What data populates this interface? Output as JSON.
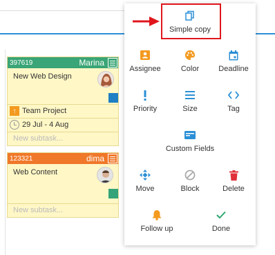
{
  "board": {
    "cards": [
      {
        "id": "397619",
        "owner": "Marina",
        "color": "#3aa576",
        "title": "New Web Design",
        "category": "Team Project",
        "dates": "29 Jul - 4 Aug",
        "subtask_placeholder": "New subtask..."
      },
      {
        "id": "123321",
        "owner": "dima",
        "color": "#f0782a",
        "title": "Web Content",
        "subtask_placeholder": "New subtask..."
      }
    ]
  },
  "menu": {
    "simple_copy": "Simple copy",
    "assignee": "Assignee",
    "color": "Color",
    "deadline": "Deadline",
    "priority": "Priority",
    "size": "Size",
    "tag": "Tag",
    "custom_fields": "Custom Fields",
    "move": "Move",
    "block": "Block",
    "delete": "Delete",
    "follow_up": "Follow up",
    "done": "Done"
  },
  "colors": {
    "accent_blue": "#2b8fd6",
    "icon_orange": "#f39a1f",
    "delete_red": "#e0303a",
    "done_green": "#2ea66e",
    "highlight_red": "#e0161c"
  }
}
